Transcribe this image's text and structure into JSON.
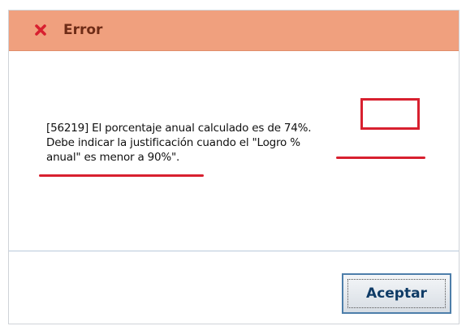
{
  "dialog": {
    "title": "Error",
    "icon": "close-icon",
    "colors": {
      "header_bg": "#f0a07e",
      "title_text": "#6e2c17",
      "icon": "#d8202f",
      "highlight": "#d8202f"
    },
    "message": {
      "line1": "[56219] El porcentaje anual calculado es de 74%.",
      "line2": "Debe indicar la justificación cuando el \"Logro %",
      "line3": "anual\" es menor a 90%\"."
    },
    "ok_label": "Aceptar"
  }
}
